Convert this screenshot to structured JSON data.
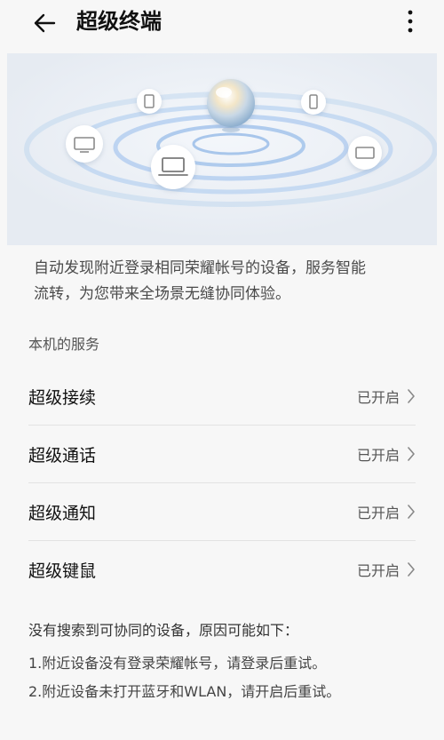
{
  "header": {
    "title": "超级终端",
    "back_icon": "arrow-left-icon",
    "more_icon": "more-vertical-icon"
  },
  "hero": {
    "devices": [
      "tablet-icon",
      "tv-icon",
      "laptop-icon",
      "phone-icon",
      "monitor-icon"
    ]
  },
  "description": {
    "line1": "自动发现附近登录相同荣耀帐号的设备，服务智能",
    "line2": "流转，为您带来全场景无缝协同体验。"
  },
  "section": {
    "title": "本机的服务"
  },
  "services": [
    {
      "name": "超级接续",
      "status": "已开启"
    },
    {
      "name": "超级通话",
      "status": "已开启"
    },
    {
      "name": "超级通知",
      "status": "已开启"
    },
    {
      "name": "超级键鼠",
      "status": "已开启"
    }
  ],
  "tips": {
    "title": "没有搜索到可协同的设备，原因可能如下：",
    "items": [
      "1.附近设备没有登录荣耀帐号，请登录后重试。",
      "2.附近设备未打开蓝牙和WLAN，请开启后重试。"
    ]
  },
  "colors": {
    "background": "#f7f7f7",
    "hero_background": "#ebeff5",
    "ripple": "#9fc3ec",
    "text_primary": "#111111",
    "text_secondary": "#555555"
  }
}
